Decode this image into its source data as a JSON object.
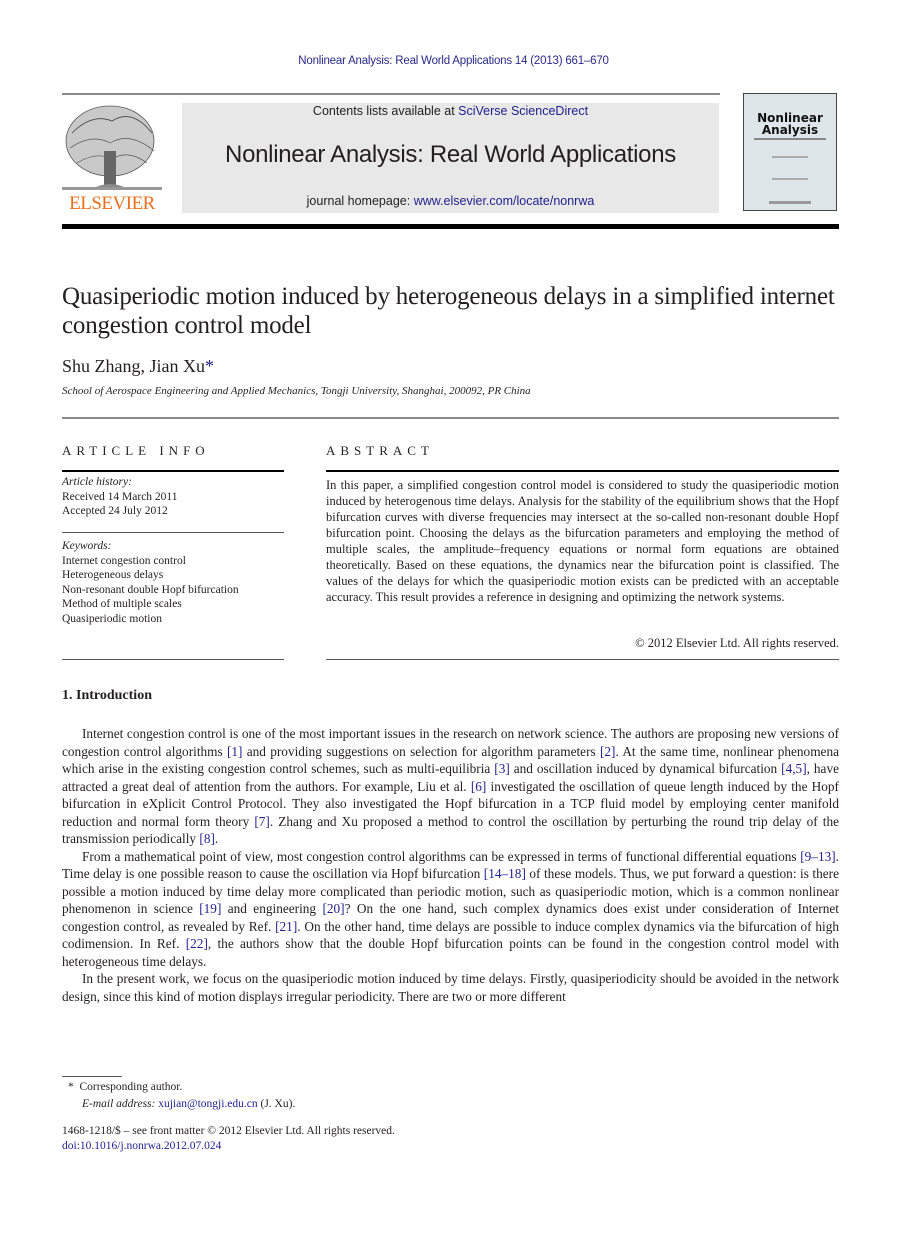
{
  "running_head": "Nonlinear Analysis: Real World Applications 14 (2013) 661–670",
  "header": {
    "publisher_logo_text": "ELSEVIER",
    "contents_prefix": "Contents lists available at ",
    "contents_link": "SciVerse ScienceDirect",
    "journal_title": "Nonlinear Analysis: Real World Applications",
    "homepage_prefix": "journal homepage: ",
    "homepage_link": "www.elsevier.com/locate/nonrwa",
    "cover_title_1": "Nonlinear",
    "cover_title_2": "Analysis"
  },
  "article": {
    "title": "Quasiperiodic motion induced by heterogeneous delays in a simplified internet congestion control model",
    "authors": "Shu Zhang, Jian Xu",
    "author_mark": "*",
    "affiliation": "School of Aerospace Engineering and Applied Mechanics, Tongji University, Shanghai, 200092, PR China"
  },
  "article_info": {
    "heading": "ARTICLE INFO",
    "history_label": "Article history:",
    "received": "Received 14 March 2011",
    "accepted": "Accepted 24 July 2012",
    "keywords_label": "Keywords:",
    "keywords": [
      "Internet congestion control",
      "Heterogeneous delays",
      "Non-resonant double Hopf bifurcation",
      "Method of multiple scales",
      "Quasiperiodic motion"
    ]
  },
  "abstract": {
    "heading": "ABSTRACT",
    "text": "In this paper, a simplified congestion control model is considered to study the quasiperiodic motion induced by heterogenous time delays. Analysis for the stability of the equilibrium shows that the Hopf bifurcation curves with diverse frequencies may intersect at the so-called non-resonant double Hopf bifurcation point. Choosing the delays as the bifurcation parameters and employing the method of multiple scales, the amplitude–frequency equations or normal form equations are obtained theoretically. Based on these equations, the dynamics near the bifurcation point is classified. The values of the delays for which the quasiperiodic motion exists can be predicted with an acceptable accuracy. This result provides a reference in designing and optimizing the network systems.",
    "copyright": "© 2012 Elsevier Ltd. All rights reserved."
  },
  "introduction": {
    "heading": "1.  Introduction",
    "p1": [
      {
        "t": "Internet congestion control is one of the most important issues in the research on network science. The authors are proposing new versions of congestion control algorithms "
      },
      {
        "r": "[1]"
      },
      {
        "t": " and providing suggestions on selection for algorithm parameters "
      },
      {
        "r": "[2]"
      },
      {
        "t": ". At the same time, nonlinear phenomena which arise in the existing congestion control schemes, such as multi-equilibria "
      },
      {
        "r": "[3]"
      },
      {
        "t": " and oscillation induced by dynamical bifurcation "
      },
      {
        "r": "[4,5]"
      },
      {
        "t": ", have attracted a great deal of attention from the authors. For example, Liu et al. "
      },
      {
        "r": "[6]"
      },
      {
        "t": " investigated the oscillation of queue length induced by the Hopf bifurcation in eXplicit Control Protocol. They also investigated the Hopf bifurcation in a TCP fluid model by employing center manifold reduction and normal form theory "
      },
      {
        "r": "[7]"
      },
      {
        "t": ". Zhang and Xu proposed a method to control the oscillation by perturbing the round trip delay of the transmission periodically "
      },
      {
        "r": "[8]"
      },
      {
        "t": "."
      }
    ],
    "p2": [
      {
        "t": "From a mathematical point of view, most congestion control algorithms can be expressed in terms of functional differential equations "
      },
      {
        "r": "[9–13]"
      },
      {
        "t": ". Time delay is one possible reason to cause the oscillation via Hopf bifurcation "
      },
      {
        "r": "[14–18]"
      },
      {
        "t": " of these models. Thus, we put forward a question: is there possible a motion induced by time delay more complicated than periodic motion, such as quasiperiodic motion, which is a common nonlinear phenomenon in science "
      },
      {
        "r": "[19]"
      },
      {
        "t": " and engineering "
      },
      {
        "r": "[20]"
      },
      {
        "t": "? On the one hand, such complex dynamics does exist under consideration of Internet congestion control, as revealed by Ref. "
      },
      {
        "r": "[21]"
      },
      {
        "t": ". On the other hand, time delays are possible to induce complex dynamics via the bifurcation of high codimension. In Ref. "
      },
      {
        "r": "[22]"
      },
      {
        "t": ", the authors show that the double Hopf bifurcation points can be found in the congestion control model with heterogeneous time delays."
      }
    ],
    "p3": [
      {
        "t": "In the present work, we focus on the quasiperiodic motion induced by time delays. Firstly, quasiperiodicity should be avoided in the network design, since this kind of motion displays irregular periodicity. There are two or more different"
      }
    ]
  },
  "footnotes": {
    "star": "*",
    "corresponding": "Corresponding author.",
    "email_label": "E-mail address: ",
    "email": "xujian@tongji.edu.cn",
    "email_suffix": " (J. Xu).",
    "front_matter": "1468-1218/$ – see front matter © 2012 Elsevier Ltd. All rights reserved.",
    "doi": "doi:10.1016/j.nonrwa.2012.07.024"
  },
  "colors": {
    "link": "#1f1f8f",
    "banner_bg": "#e8e8e8",
    "elsevier_orange": "#e9711c"
  }
}
